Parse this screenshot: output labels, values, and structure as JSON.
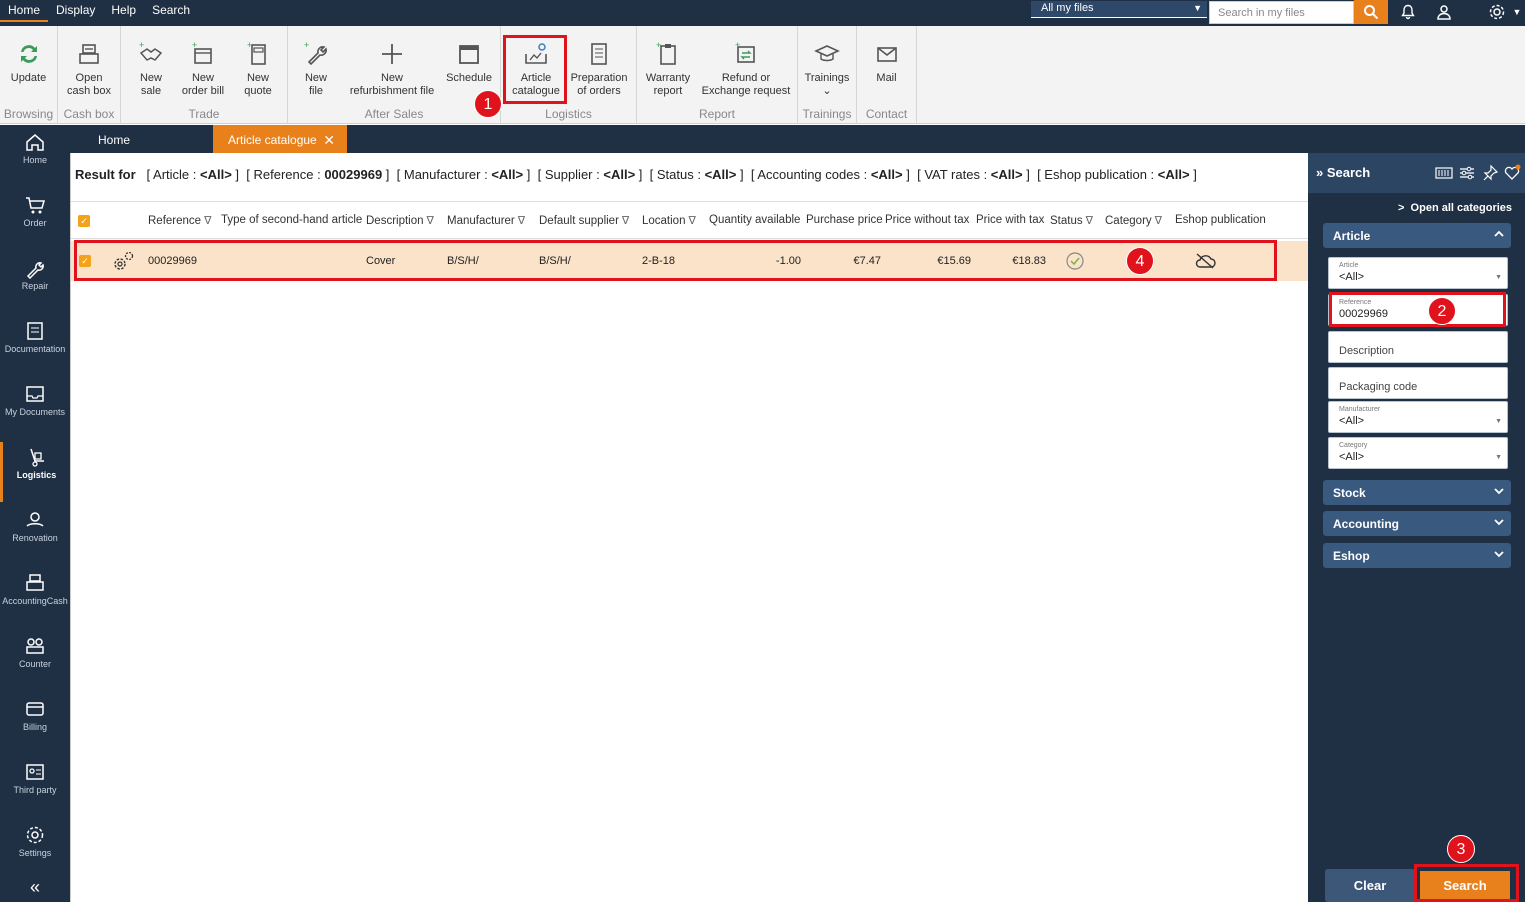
{
  "topmenu": [
    "Home",
    "Display",
    "Help",
    "Search"
  ],
  "scope_select": "All my files",
  "top_search_placeholder": "Search in my files",
  "ribbon": {
    "browsing": {
      "label": "Browsing",
      "update": "Update"
    },
    "cashbox": {
      "label": "Cash box",
      "open_line1": "Open",
      "open_line2": "cash box"
    },
    "trade": {
      "label": "Trade",
      "new_sale_l1": "New",
      "new_sale_l2": "sale",
      "new_order_l1": "New",
      "new_order_l2": "order bill",
      "new_quote_l1": "New",
      "new_quote_l2": "quote"
    },
    "aftersales": {
      "label": "After Sales",
      "new_file_l1": "New",
      "new_file_l2": "file",
      "new_refurb_l1": "New",
      "new_refurb_l2": "refurbishment file",
      "schedule": "Schedule"
    },
    "logistics": {
      "label": "Logistics",
      "catalogue_l1": "Article",
      "catalogue_l2": "catalogue",
      "prep_l1": "Preparation",
      "prep_l2": "of orders"
    },
    "report": {
      "label": "Report",
      "warranty_l1": "Warranty",
      "warranty_l2": "report",
      "refund_l1": "Refund or",
      "refund_l2": "Exchange request"
    },
    "trainings": {
      "label": "Trainings",
      "btn": "Trainings"
    },
    "contact": {
      "label": "Contact",
      "mail": "Mail"
    }
  },
  "badges": {
    "one": "1",
    "two": "2",
    "three": "3",
    "four": "4"
  },
  "leftnav": [
    "Home",
    "Order",
    "Repair",
    "Documentation",
    "My Documents",
    "Logistics",
    "Renovation",
    "AccountingCash",
    "Counter",
    "Billing",
    "Third party",
    "Settings"
  ],
  "tabs": {
    "home": "Home",
    "active": "Article catalogue",
    "close": "✕"
  },
  "resultbar": {
    "prefix": "Result for",
    "filters": [
      {
        "name": "Article",
        "value": "<All>"
      },
      {
        "name": "Reference",
        "value": "00029969"
      },
      {
        "name": "Manufacturer",
        "value": "<All>"
      },
      {
        "name": "Supplier",
        "value": "<All>"
      },
      {
        "name": "Status",
        "value": "<All>"
      },
      {
        "name": "Accounting codes",
        "value": "<All>"
      },
      {
        "name": "VAT rates",
        "value": "<All>"
      },
      {
        "name": "Eshop publication",
        "value": "<All>"
      }
    ]
  },
  "columns": [
    "Reference",
    "Type of second-hand article",
    "Description",
    "Manufacturer",
    "Default supplier",
    "Location",
    "Quantity available",
    "Purchase price",
    "Price without tax",
    "Price with tax",
    "Status",
    "Category",
    "Eshop publication"
  ],
  "row": {
    "reference": "00029969",
    "description": "Cover",
    "manufacturer": "B/S/H/",
    "supplier": "B/S/H/",
    "location": "2-B-18",
    "quantity": "-1.00",
    "purchase_price": "€7.47",
    "price_no_tax": "€15.69",
    "price_tax": "€18.83"
  },
  "panel": {
    "title": "Search",
    "open_categories": "Open all categories",
    "sections": {
      "article": "Article",
      "stock": "Stock",
      "accounting": "Accounting",
      "eshop": "Eshop"
    },
    "fields": {
      "article_label": "Article",
      "article_value": "<All>",
      "reference_label": "Reference",
      "reference_value": "00029969",
      "description_placeholder": "Description",
      "packaging_placeholder": "Packaging code",
      "manufacturer_label": "Manufacturer",
      "manufacturer_value": "<All>",
      "category_label": "Category",
      "category_value": "<All>"
    },
    "clear": "Clear",
    "search": "Search"
  },
  "colors": {
    "accent": "#e8811c",
    "navy": "#1f2f44",
    "highlight": "#e0121c",
    "row": "#fbe3c9"
  }
}
